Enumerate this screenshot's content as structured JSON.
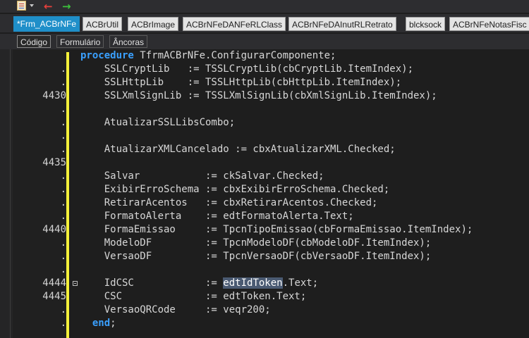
{
  "toolbar": {
    "icons": [
      "document-icon",
      "dropdown-arrow-icon",
      "back-arrow-icon",
      "forward-arrow-icon"
    ]
  },
  "file_tabs": [
    {
      "label": "*Frm_ACBrNFe",
      "active": true
    },
    {
      "label": "ACBrUtil",
      "active": false
    },
    {
      "label": "ACBrImage",
      "active": false
    },
    {
      "label": "ACBrNFeDANFeRLClass",
      "active": false
    },
    {
      "label": "ACBrNFeDAInutRLRetrato",
      "active": false
    },
    {
      "label": "blcksock",
      "active": false
    },
    {
      "label": "ACBrNFeNotasFisc",
      "active": false
    }
  ],
  "view_tabs": [
    {
      "label": "Código",
      "active": true
    },
    {
      "label": "Formulário",
      "active": false
    },
    {
      "label": "Âncoras",
      "active": false
    }
  ],
  "editor": {
    "lines": [
      {
        "num": "",
        "pre": "",
        "kw": "procedure",
        "post": " TfrmACBrNFe.ConfigurarComponente;",
        "sel": "",
        "tail": ""
      },
      {
        "num": ".",
        "pre": "    SSLCryptLib   := TSSLCryptLib(cbCryptLib.ItemIndex);",
        "kw": "",
        "post": "",
        "sel": "",
        "tail": ""
      },
      {
        "num": ".",
        "pre": "    SSLHttpLib    := TSSLHttpLib(cbHttpLib.ItemIndex);",
        "kw": "",
        "post": "",
        "sel": "",
        "tail": ""
      },
      {
        "num": "4430",
        "pre": "    SSLXmlSignLib := TSSLXmlSignLib(cbXmlSignLib.ItemIndex);",
        "kw": "",
        "post": "",
        "sel": "",
        "tail": ""
      },
      {
        "num": ".",
        "pre": "",
        "kw": "",
        "post": "",
        "sel": "",
        "tail": ""
      },
      {
        "num": ".",
        "pre": "    AtualizarSSLLibsCombo;",
        "kw": "",
        "post": "",
        "sel": "",
        "tail": ""
      },
      {
        "num": ".",
        "pre": "",
        "kw": "",
        "post": "",
        "sel": "",
        "tail": ""
      },
      {
        "num": ".",
        "pre": "    AtualizarXMLCancelado := cbxAtualizarXML.Checked;",
        "kw": "",
        "post": "",
        "sel": "",
        "tail": ""
      },
      {
        "num": "4435",
        "pre": "",
        "kw": "",
        "post": "",
        "sel": "",
        "tail": ""
      },
      {
        "num": ".",
        "pre": "    Salvar           := ckSalvar.Checked;",
        "kw": "",
        "post": "",
        "sel": "",
        "tail": ""
      },
      {
        "num": ".",
        "pre": "    ExibirErroSchema := cbxExibirErroSchema.Checked;",
        "kw": "",
        "post": "",
        "sel": "",
        "tail": ""
      },
      {
        "num": ".",
        "pre": "    RetirarAcentos   := cbxRetirarAcentos.Checked;",
        "kw": "",
        "post": "",
        "sel": "",
        "tail": ""
      },
      {
        "num": ".",
        "pre": "    FormatoAlerta    := edtFormatoAlerta.Text;",
        "kw": "",
        "post": "",
        "sel": "",
        "tail": ""
      },
      {
        "num": "4440",
        "pre": "    FormaEmissao     := TpcnTipoEmissao(cbFormaEmissao.ItemIndex);",
        "kw": "",
        "post": "",
        "sel": "",
        "tail": ""
      },
      {
        "num": ".",
        "pre": "    ModeloDF         := TpcnModeloDF(cbModeloDF.ItemIndex);",
        "kw": "",
        "post": "",
        "sel": "",
        "tail": ""
      },
      {
        "num": ".",
        "pre": "    VersaoDF         := TpcnVersaoDF(cbVersaoDF.ItemIndex);",
        "kw": "",
        "post": "",
        "sel": "",
        "tail": ""
      },
      {
        "num": ".",
        "pre": "",
        "kw": "",
        "post": "",
        "sel": "",
        "tail": ""
      },
      {
        "num": "4444",
        "pre": "    IdCSC            := ",
        "kw": "",
        "post": "",
        "sel": "edtIdToken",
        "tail": ".Text;",
        "fold": true
      },
      {
        "num": "4445",
        "pre": "    CSC              := edtToken.Text;",
        "kw": "",
        "post": "",
        "sel": "",
        "tail": ""
      },
      {
        "num": ".",
        "pre": "    VersaoQRCode     := veqr200;",
        "kw": "",
        "post": "",
        "sel": "",
        "tail": ""
      },
      {
        "num": ".",
        "pre": "  ",
        "kw": "end",
        "post": ";",
        "sel": "",
        "tail": ""
      }
    ]
  },
  "colors": {
    "keyword": "#3aa0ff",
    "change_bar": "#f4f03a",
    "active_tab": "#1f8fc9",
    "back_arrow": "#e8403c",
    "forward_arrow": "#3cc23c"
  }
}
